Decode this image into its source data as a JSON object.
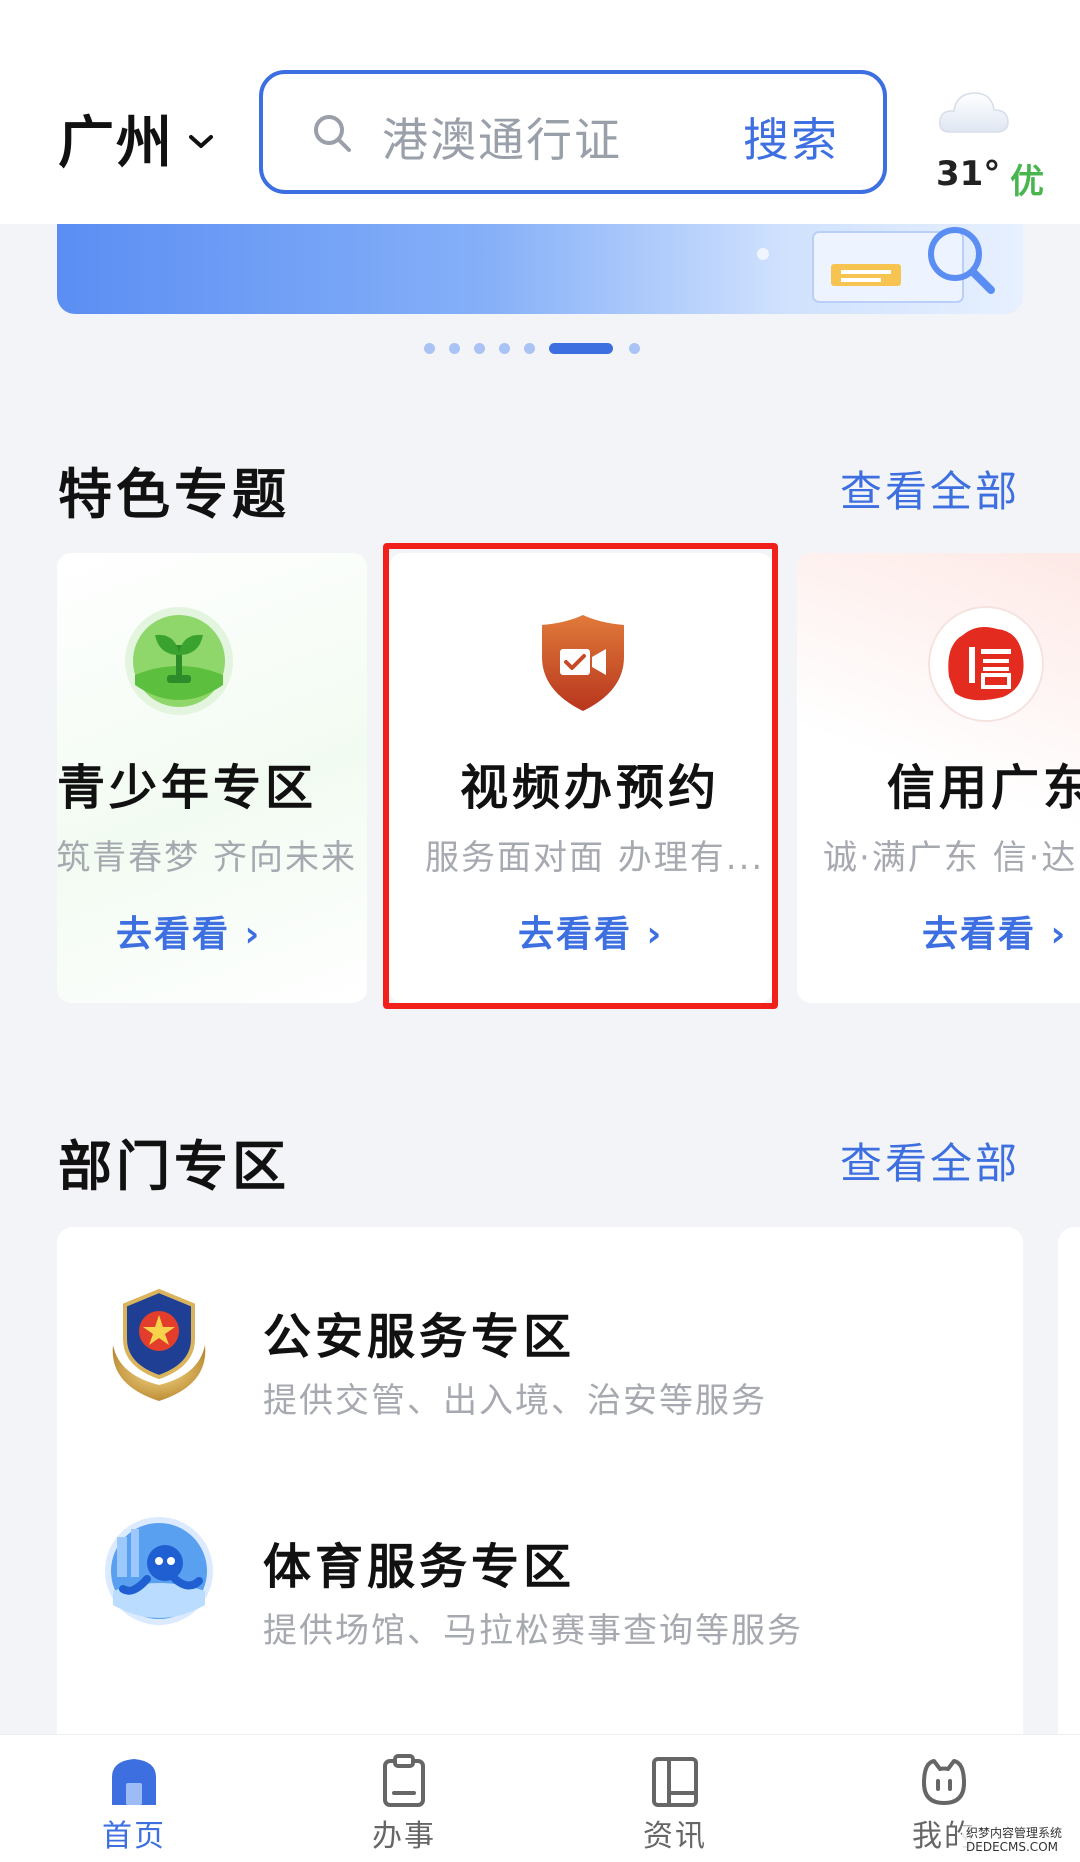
{
  "header": {
    "city": "广州",
    "search": {
      "placeholder": "港澳通行证",
      "button": "搜索"
    },
    "weather": {
      "icon": "cloud-icon",
      "temperature": "31°",
      "air_quality": "优"
    }
  },
  "banner": {
    "carousel_dots": 7,
    "active_index": 5
  },
  "featured": {
    "title": "特色专题",
    "view_all": "查看全部",
    "cards": [
      {
        "icon": "sprout-icon",
        "title": "青少年专区",
        "subtitle": "筑青春梦 齐向未来",
        "action": "去看看 ›"
      },
      {
        "icon": "video-shield-icon",
        "title": "视频办预约",
        "subtitle": "服务面对面 办理有...",
        "action": "去看看 ›"
      },
      {
        "icon": "credit-seal-icon",
        "title": "信用广东",
        "subtitle": "诚·满广东 信·达",
        "action": "去看看 ›"
      }
    ]
  },
  "departments": {
    "title": "部门专区",
    "view_all": "查看全部",
    "items": [
      {
        "icon": "police-badge-icon",
        "title": "公安服务专区",
        "description": "提供交管、出入境、治安等服务"
      },
      {
        "icon": "sports-mascot-icon",
        "title": "体育服务专区",
        "description": "提供场馆、马拉松赛事查询等服务"
      }
    ]
  },
  "tabbar": {
    "tabs": [
      {
        "icon": "home-icon",
        "label": "首页",
        "active": true
      },
      {
        "icon": "clipboard-icon",
        "label": "办事",
        "active": false
      },
      {
        "icon": "news-icon",
        "label": "资讯",
        "active": false
      },
      {
        "icon": "mine-icon",
        "label": "我的",
        "active": false
      }
    ]
  },
  "watermark": "织梦内容管理系统 DEDECMS.COM",
  "colors": {
    "accent": "#3d6fe0",
    "highlight_border": "#f2201b",
    "aqi_good": "#49b54e",
    "muted_text": "#a6a9b0"
  }
}
